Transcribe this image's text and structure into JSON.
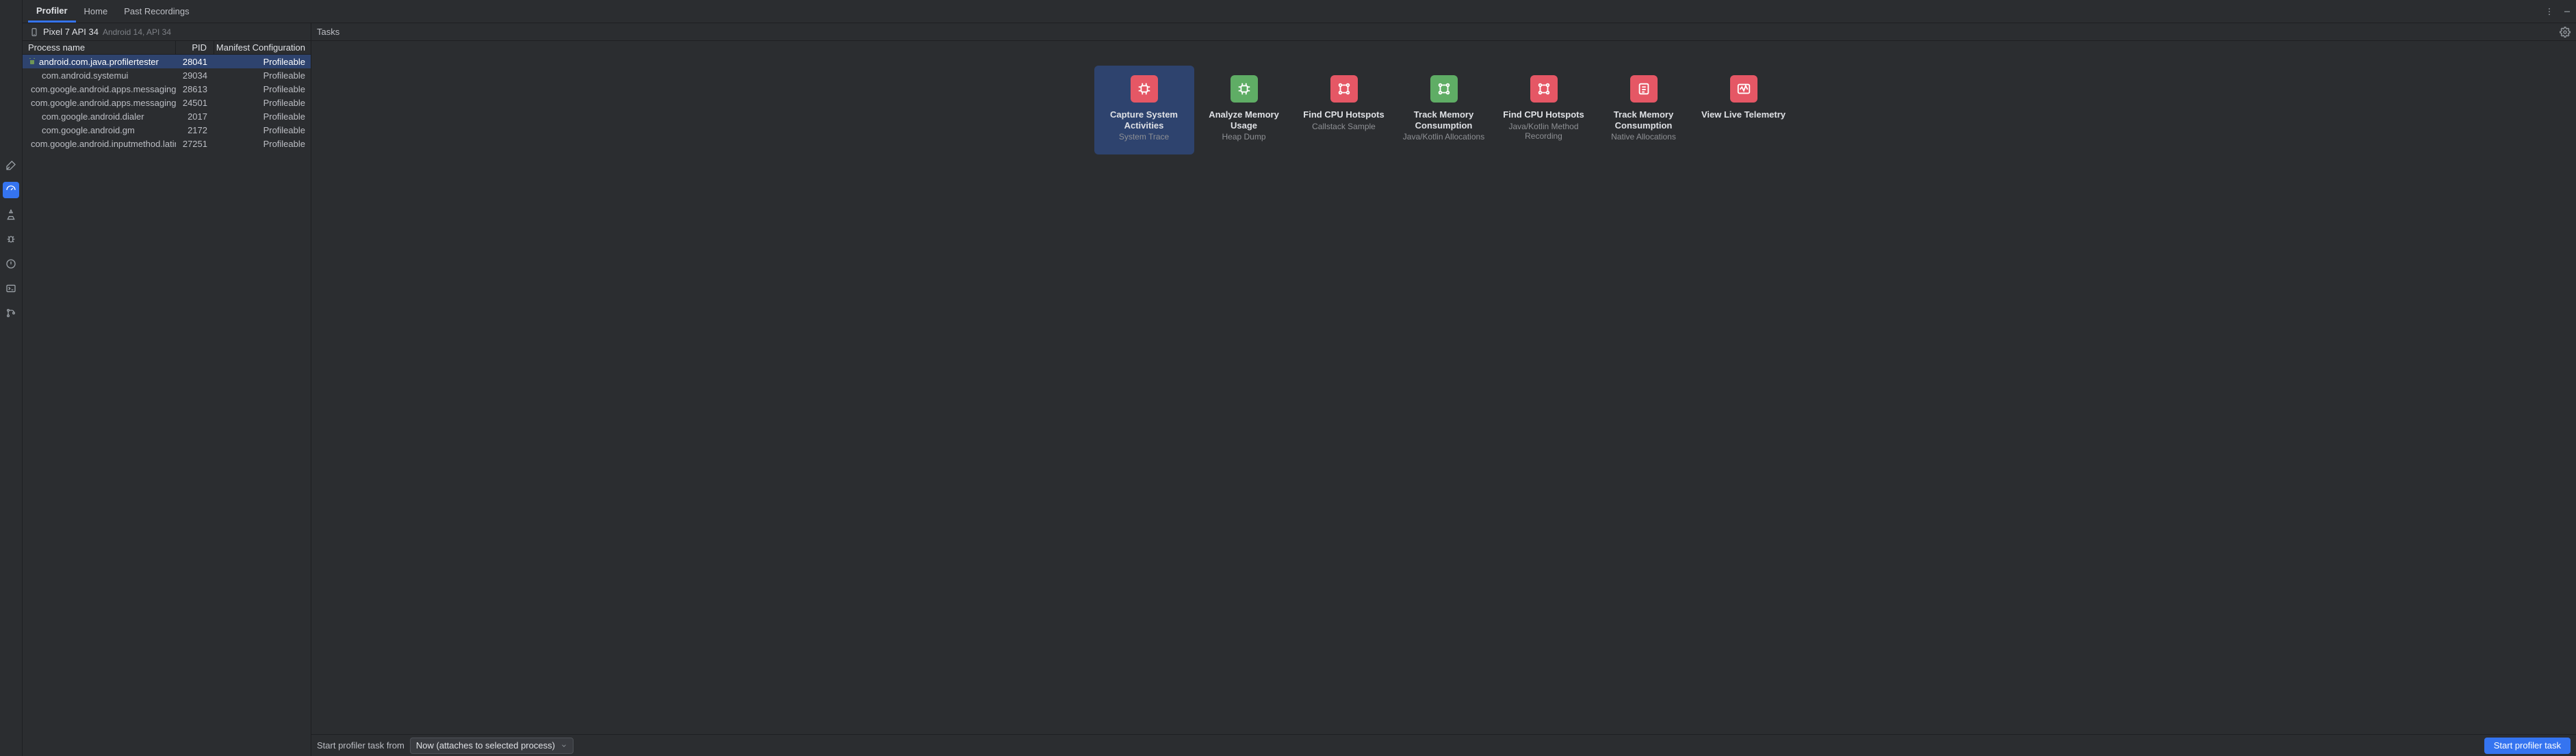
{
  "tabs": {
    "profiler": "Profiler",
    "home": "Home",
    "past": "Past Recordings"
  },
  "device": {
    "name": "Pixel 7 API 34",
    "sub": "Android 14, API 34"
  },
  "proc_headers": {
    "name": "Process name",
    "pid": "PID",
    "manifest": "Manifest Configuration"
  },
  "processes": [
    {
      "name": "android.com.java.profilertester",
      "pid": "28041",
      "manifest": "Profileable",
      "selected": true,
      "has_icon": true
    },
    {
      "name": "com.android.systemui",
      "pid": "29034",
      "manifest": "Profileable"
    },
    {
      "name": "com.google.android.apps.messaging",
      "pid": "28613",
      "manifest": "Profileable"
    },
    {
      "name": "com.google.android.apps.messaging…",
      "pid": "24501",
      "manifest": "Profileable"
    },
    {
      "name": "com.google.android.dialer",
      "pid": "2017",
      "manifest": "Profileable"
    },
    {
      "name": "com.google.android.gm",
      "pid": "2172",
      "manifest": "Profileable"
    },
    {
      "name": "com.google.android.inputmethod.latin",
      "pid": "27251",
      "manifest": "Profileable"
    }
  ],
  "right_header": "Tasks",
  "tasks": [
    {
      "title": "Capture System Activities",
      "sub": "System Trace",
      "color": "red",
      "icon": "cpu",
      "selected": true
    },
    {
      "title": "Analyze Memory Usage",
      "sub": "Heap Dump",
      "color": "green",
      "icon": "cpu"
    },
    {
      "title": "Find CPU Hotspots",
      "sub": "Callstack Sample",
      "color": "red",
      "icon": "sample"
    },
    {
      "title": "Track Memory Consumption",
      "sub": "Java/Kotlin Allocations",
      "color": "green",
      "icon": "sample"
    },
    {
      "title": "Find CPU Hotspots",
      "sub": "Java/Kotlin Method Recording",
      "color": "red",
      "icon": "sample"
    },
    {
      "title": "Track Memory Consumption",
      "sub": "Native Allocations",
      "color": "red",
      "icon": "list"
    },
    {
      "title": "View Live Telemetry",
      "sub": "",
      "color": "red",
      "icon": "pulse"
    }
  ],
  "footer": {
    "label": "Start profiler task from",
    "combo_value": "Now (attaches to selected process)",
    "button": "Start profiler task"
  }
}
